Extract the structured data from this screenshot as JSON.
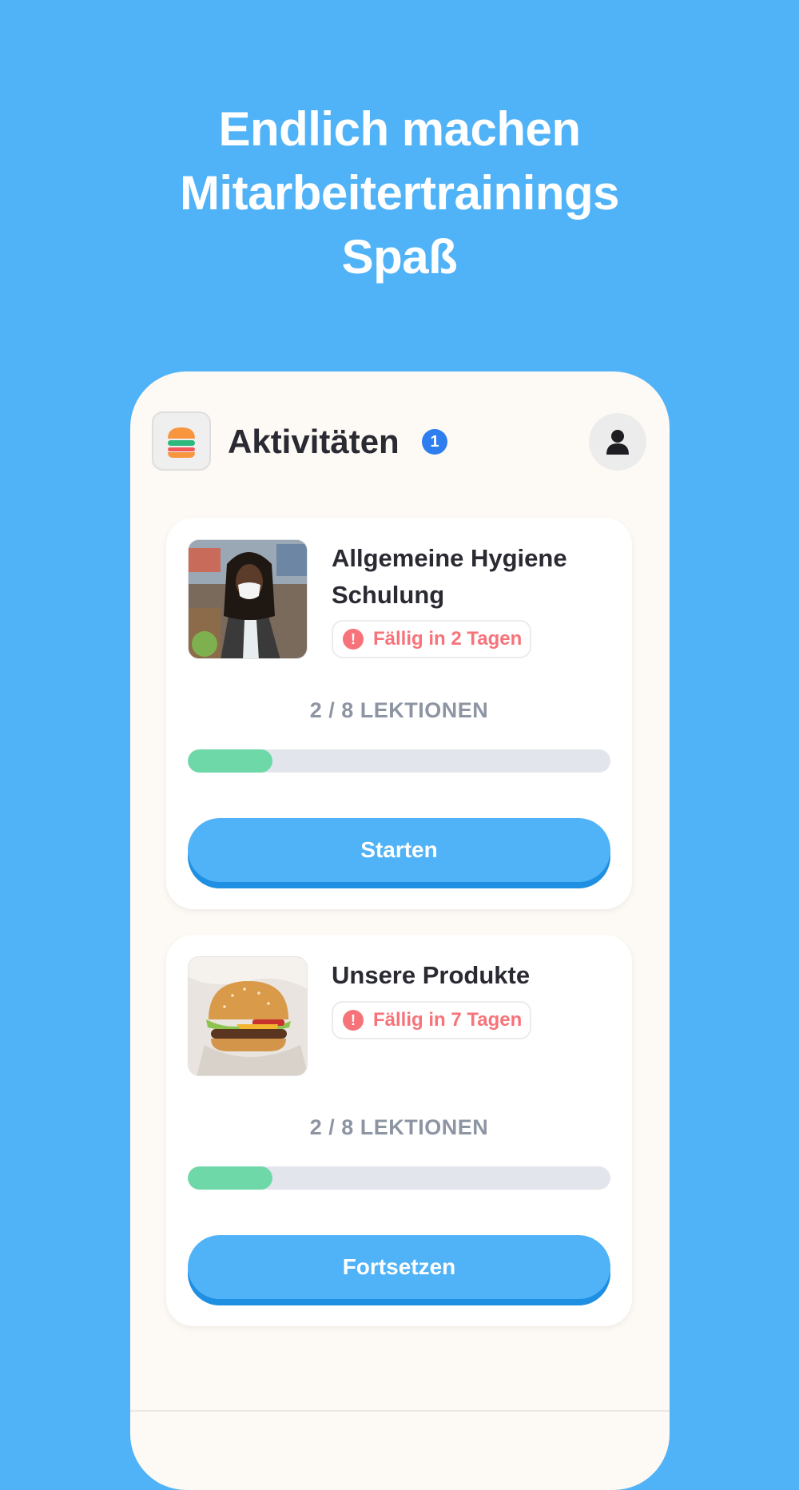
{
  "hero": {
    "title_lines": [
      "Endlich machen",
      "Mitarbeitertrainings",
      "Spaß"
    ]
  },
  "app": {
    "logo_icon": "burger-logo-icon",
    "header_title": "Aktivitäten",
    "notification_count": "1",
    "profile_icon": "user-icon"
  },
  "courses": [
    {
      "title": "Allgemeine Hygiene Schulung",
      "thumbnail": "woman-with-mask-photo",
      "due_icon": "!",
      "due_text": "Fällig in 2 Tagen",
      "lessons_text": "2 / 8 LEKTIONEN",
      "progress": 0.2,
      "button_label": "Starten"
    },
    {
      "title": "Unsere Produkte",
      "thumbnail": "burger-photo",
      "due_icon": "!",
      "due_text": "Fällig in 7 Tagen",
      "lessons_text": "2 / 8 LEKTIONEN",
      "progress": 0.2,
      "button_label": "Fortsetzen"
    }
  ],
  "colors": {
    "background": "#50b2f7",
    "accent_blue": "#2f7ef0",
    "due_red": "#f7737a",
    "progress_green": "#6fd8a9",
    "progress_track": "#e2e5ec",
    "button_shadow": "#1f8fe2"
  }
}
